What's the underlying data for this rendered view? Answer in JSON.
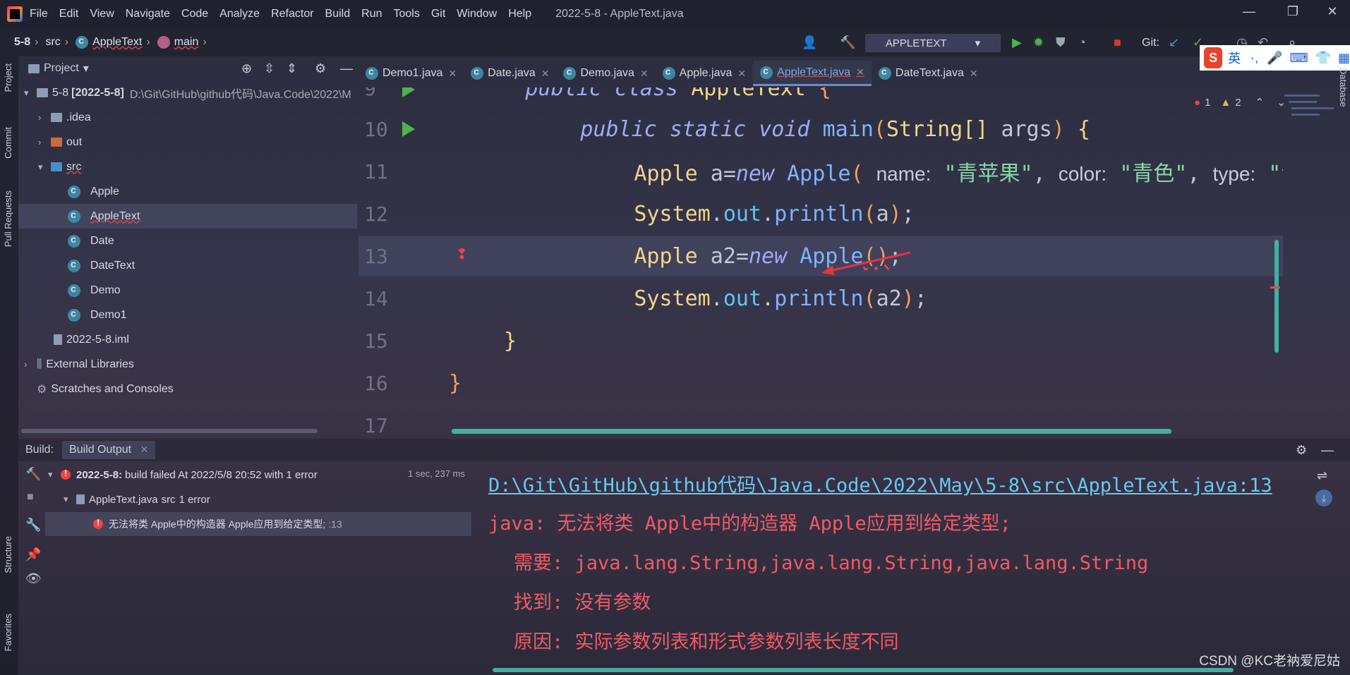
{
  "menubar": {
    "items": [
      "File",
      "Edit",
      "View",
      "Navigate",
      "Code",
      "Analyze",
      "Refactor",
      "Build",
      "Run",
      "Tools",
      "Git",
      "Window",
      "Help"
    ],
    "window_title": "2022-5-8 - AppleText.java"
  },
  "navbar": {
    "crumbs": [
      "5-8",
      "src",
      "AppleText",
      "main"
    ],
    "run_config": "APPLETEXT",
    "git_label": "Git:"
  },
  "left_stripe": {
    "tabs": [
      "Project",
      "Commit",
      "Pull Requests",
      "Structure",
      "Favorites"
    ]
  },
  "right_stripe": {
    "tabs": [
      "Database"
    ]
  },
  "project": {
    "header": "Project",
    "root_label": "5-8",
    "root_bold": "[2022-5-8]",
    "root_path": "D:\\Git\\GitHub\\github代码\\Java.Code\\2022\\M",
    "items": [
      ".idea",
      "out",
      "src",
      "Apple",
      "AppleText",
      "Date",
      "DateText",
      "Demo",
      "Demo1",
      "2022-5-8.iml",
      "External Libraries",
      "Scratches and Consoles"
    ]
  },
  "editor_tabs": [
    "Demo1.java",
    "Date.java",
    "Demo.java",
    "Apple.java",
    "AppleText.java",
    "DateText.java"
  ],
  "inspections": {
    "errors": "1",
    "warnings": "2"
  },
  "editor": {
    "line_numbers": [
      "9",
      "10",
      "11",
      "12",
      "13",
      "14",
      "15",
      "16",
      "17"
    ],
    "line9": {
      "kw1": "public",
      "kw2": "class",
      "name": "AppleText",
      "brace": "{"
    },
    "line10": {
      "kw1": "public",
      "kw2": "static",
      "kw3": "void",
      "fn": "main",
      "lp": "(",
      "type": "String[]",
      "arg": "args",
      "rp": ")",
      "brace": "{"
    },
    "line11": {
      "type": "Apple",
      "var": "a",
      "eq": "=",
      "kw": "new",
      "ctor": "Apple",
      "lp": "(",
      "hint1": "name:",
      "s1": "\"青苹果\"",
      "comma1": ",",
      "hint2": "color:",
      "s2": "\"青色\"",
      "comma2": ",",
      "hint3": "type:",
      "s3": "\"青春苹果"
    },
    "line12": {
      "cls": "System",
      "dot1": ".",
      "field": "out",
      "dot2": ".",
      "fn": "println",
      "lp": "(",
      "arg": "a",
      "rp": ")",
      "semi": ";"
    },
    "line13": {
      "type": "Apple",
      "var": "a2",
      "eq": "=",
      "kw": "new",
      "ctor": "Apple",
      "lp": "(",
      "rp": ")",
      "semi": ";"
    },
    "line14": {
      "cls": "System",
      "dot1": ".",
      "field": "out",
      "dot2": ".",
      "fn": "println",
      "lp": "(",
      "arg": "a2",
      "rp": ")",
      "semi": ";"
    },
    "line15": {
      "brace": "}"
    },
    "line16": {
      "brace": "}"
    }
  },
  "build": {
    "label": "Build:",
    "tab": "Build Output",
    "root": "2022-5-8:",
    "root_msg": "build failed At 2022/5/8 20:52 with 1 error",
    "duration": "1 sec, 237 ms",
    "file_row_name": "AppleText.java",
    "file_row_dir": "src",
    "file_row_count": "1 error",
    "error_row": "无法将类 Apple中的构造器 Apple应用到给定类型;",
    "error_row_line": ":13"
  },
  "console": {
    "link": "D:\\Git\\GitHub\\github代码\\Java.Code\\2022\\May\\5-8\\src\\AppleText.java:13",
    "err1": "java: 无法将类 Apple中的构造器 Apple应用到给定类型;",
    "err2": "需要: java.lang.String,java.lang.String,java.lang.String",
    "err3": "找到: 没有参数",
    "err4": "原因: 实际参数列表和形式参数列表长度不同"
  },
  "ime": {
    "logo": "S",
    "mode": "英"
  },
  "watermark": "CSDN @KC老衲爱尼姑"
}
